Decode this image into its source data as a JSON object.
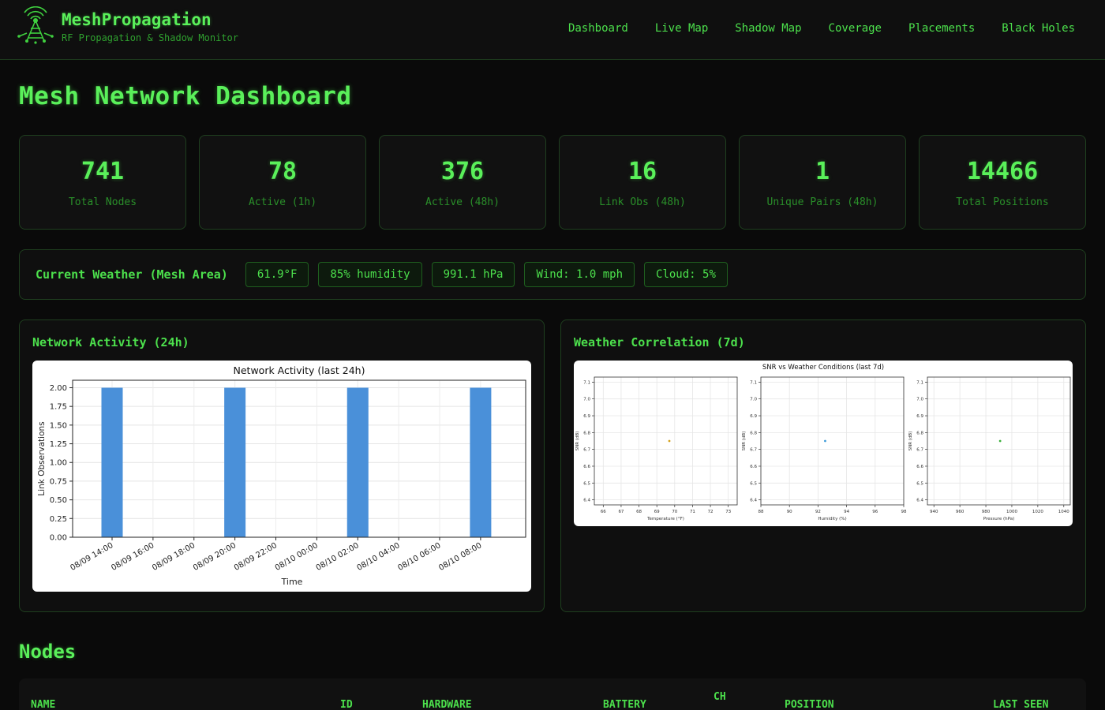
{
  "app": {
    "title": "MeshPropagation",
    "subtitle": "RF Propagation & Shadow Monitor"
  },
  "nav": {
    "items": [
      "Dashboard",
      "Live Map",
      "Shadow Map",
      "Coverage",
      "Placements",
      "Black Holes"
    ]
  },
  "page": {
    "title": "Mesh Network Dashboard"
  },
  "stats": [
    {
      "value": "741",
      "label": "Total Nodes"
    },
    {
      "value": "78",
      "label": "Active (1h)"
    },
    {
      "value": "376",
      "label": "Active (48h)"
    },
    {
      "value": "16",
      "label": "Link Obs (48h)"
    },
    {
      "value": "1",
      "label": "Unique Pairs (48h)"
    },
    {
      "value": "14466",
      "label": "Total Positions"
    }
  ],
  "weather": {
    "label": "Current Weather (Mesh Area)",
    "chips": [
      "61.9°F",
      "85% humidity",
      "991.1 hPa",
      "Wind: 1.0 mph",
      "Cloud: 5%"
    ]
  },
  "panels": {
    "activity_title": "Network Activity (24h)",
    "weather_title": "Weather Correlation (7d)"
  },
  "chart_data": [
    {
      "type": "bar",
      "title": "Network Activity (last 24h)",
      "xlabel": "Time",
      "ylabel": "Link Observations",
      "ylim": [
        0,
        2.1
      ],
      "yticks": [
        "0.00",
        "0.25",
        "0.50",
        "0.75",
        "1.00",
        "1.25",
        "1.50",
        "1.75",
        "2.00"
      ],
      "xticks": [
        "08/09 14:00",
        "08/09 16:00",
        "08/09 18:00",
        "08/09 20:00",
        "08/09 22:00",
        "08/10 00:00",
        "08/10 02:00",
        "08/10 04:00",
        "08/10 06:00",
        "08/10 08:00"
      ],
      "bars": [
        {
          "x": "08/09 14:00",
          "value": 2
        },
        {
          "x": "08/09 20:00",
          "value": 2
        },
        {
          "x": "08/10 02:00",
          "value": 2
        },
        {
          "x": "08/10 08:00",
          "value": 2
        }
      ],
      "color": "#4a90d9",
      "grid": true
    },
    {
      "type": "scatter",
      "title": "SNR vs Weather Conditions (last 7d)",
      "subplots": [
        {
          "xlabel": "Temperature (°F)",
          "ylabel": "SNR (dB)",
          "xticks": [
            "66",
            "67",
            "68",
            "69",
            "70",
            "71",
            "72",
            "73"
          ],
          "xlim": [
            65.5,
            73.5
          ],
          "points": [
            {
              "x": 69.7,
              "y": 6.75
            }
          ],
          "color": "#d4a017"
        },
        {
          "xlabel": "Humidity (%)",
          "ylabel": "SNR (dB)",
          "xticks": [
            "88",
            "90",
            "92",
            "94",
            "96",
            "98"
          ],
          "xlim": [
            88,
            98
          ],
          "points": [
            {
              "x": 92.5,
              "y": 6.75
            }
          ],
          "color": "#3a9ad9"
        },
        {
          "xlabel": "Pressure (hPa)",
          "ylabel": "SNR (dB)",
          "xticks": [
            "940",
            "960",
            "980",
            "1000",
            "1020",
            "1040"
          ],
          "xlim": [
            935,
            1045
          ],
          "points": [
            {
              "x": 991,
              "y": 6.75
            }
          ],
          "color": "#3ab03a"
        }
      ],
      "ylim": [
        6.37,
        7.13
      ],
      "yticks": [
        "6.4",
        "6.5",
        "6.6",
        "6.7",
        "6.8",
        "6.9",
        "7.0",
        "7.1"
      ],
      "grid": true
    }
  ],
  "nodes": {
    "title": "Nodes",
    "columns": [
      "Name",
      "ID",
      "Hardware",
      "Battery",
      "Ch",
      "Position",
      "Last Seen"
    ]
  }
}
